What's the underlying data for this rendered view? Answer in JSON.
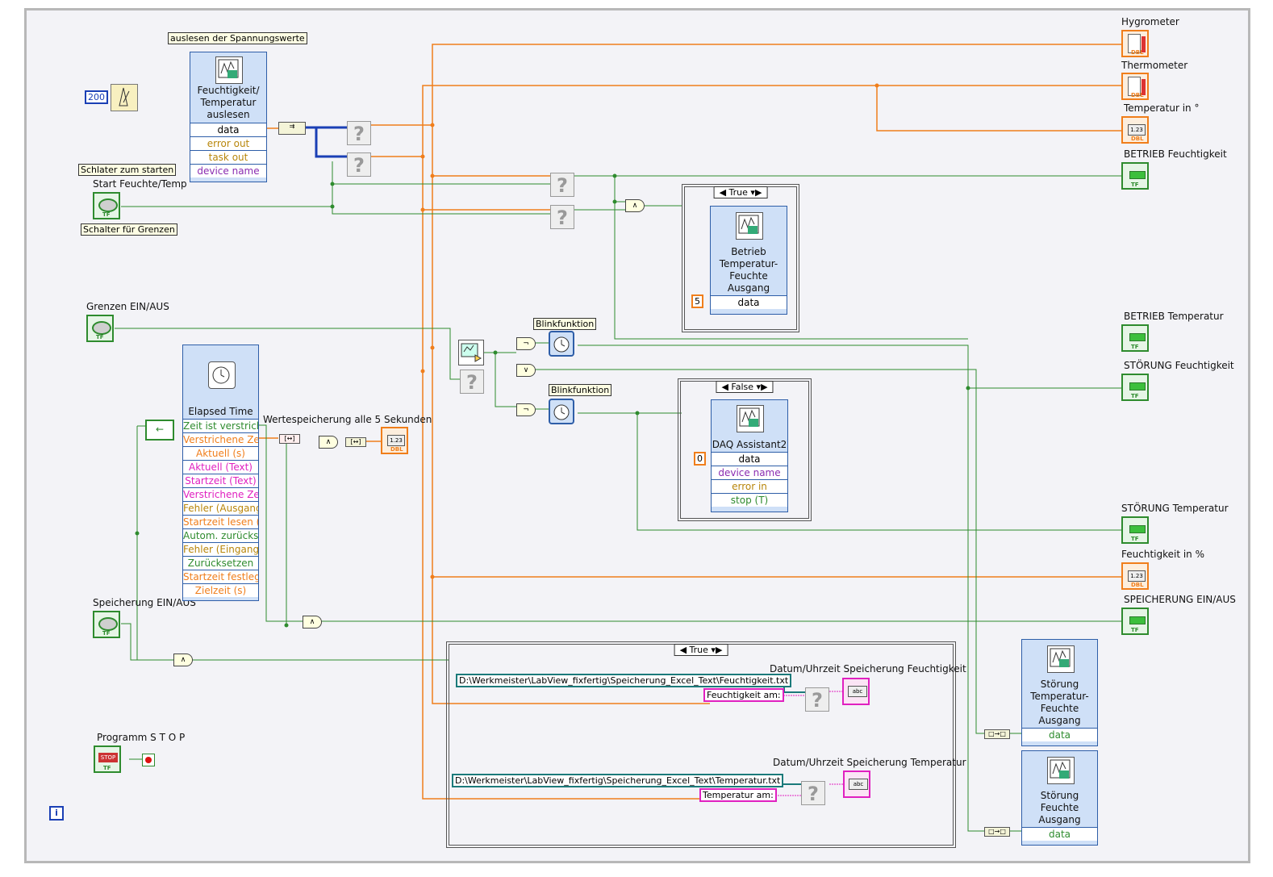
{
  "labels": {
    "hygrometer": "Hygrometer",
    "thermometer": "Thermometer",
    "temperatur_in": "Temperatur in °",
    "betrieb_feuchtigkeit": "BETRIEB Feuchtigkeit",
    "betrieb_temperatur": "BETRIEB Temperatur",
    "stoerung_feuchtigkeit": "STÖRUNG Feuchtigkeit",
    "stoerung_temperatur": "STÖRUNG Temperatur",
    "feuchtigkeit_in": "Feuchtigkeit in %",
    "speicherung_ein_aus_ind": "SPEICHERUNG EIN/AUS",
    "start_feuchte_temp": "Start Feuchte/Temp",
    "grenzen_ein_aus": "Grenzen EIN/AUS",
    "speicherung_ein_aus_ctrl": "Speicherung EIN/AUS",
    "programm_stop": "Programm S T O P",
    "wertespeicherung": "Wertespeicherung alle 5 Sekunden",
    "datum_uhrzeit_feuchtigkeit": "Datum/Uhrzeit Speicherung Feuchtigkeit",
    "datum_uhrzeit_temperatur": "Datum/Uhrzeit Speicherung Temperatur"
  },
  "free_labels": {
    "auslesen": "auslesen der Spannungswerte",
    "schalter_starten": "Schlater zum starten",
    "schalter_grenzen": "Schalter für Grenzen",
    "blink1": "Blinkfunktion",
    "blink2": "Blinkfunktion"
  },
  "constants": {
    "wait_ms": "200",
    "case1_const": "5",
    "case2_const": "0",
    "path_feuchte": "D:\\Werkmeister\\LabView_fixfertig\\Speicherung_Excel_Text\\Feuchtigkeit.txt",
    "path_temp": "D:\\Werkmeister\\LabView_fixfertig\\Speicherung_Excel_Text\\Temperatur.txt",
    "str_feuchte": "Feuchtigkeit am:",
    "str_temp": "Temperatur am:"
  },
  "express_vis": {
    "daq_read": {
      "title": "Feuchtigkeit/ Temperatur auslesen",
      "terminals": [
        "data",
        "error out",
        "task out",
        "device name"
      ]
    },
    "elapsed": {
      "title": "Elapsed Time",
      "terminals": [
        "Zeit ist verstrich",
        "Verstrichene Zei",
        "Aktuell (s)",
        "Aktuell (Text)",
        "Startzeit (Text)",
        "Verstrichene Zei",
        "Fehler (Ausgang",
        "Startzeit lesen (s",
        "Autom. zurücks",
        "Fehler (Eingang,",
        "Zurücksetzen",
        "Startzeit festlege",
        "Zielzeit (s)"
      ]
    },
    "betrieb_out": {
      "title": "Betrieb Temperatur- Feuchte Ausgang",
      "terminals": [
        "data"
      ]
    },
    "daq2": {
      "title": "DAQ Assistant2",
      "terminals": [
        "data",
        "device name",
        "error in",
        "stop (T)"
      ]
    },
    "stoerung_tf": {
      "title": "Störung Temperatur- Feuchte Ausgang",
      "terminals": [
        "data"
      ]
    },
    "stoerung_f": {
      "title": "Störung Feuchte Ausgang",
      "terminals": [
        "data"
      ]
    }
  },
  "cases": {
    "case_betrieb": "True",
    "case_daq2": "False",
    "case_speicher": "True"
  },
  "indicator_types": {
    "dbl": "DBL",
    "tf": "TF",
    "num_display": "1.23",
    "stop": "STOP",
    "abc": "abc"
  },
  "colors": {
    "wire_orange": "#f07e1b",
    "wire_green": "#2e8b2e",
    "wire_blue": "#1a3fb5",
    "wire_pink": "#e020c0",
    "wire_teal": "#1b7a7a",
    "express_blue": "#cfe0f7"
  }
}
